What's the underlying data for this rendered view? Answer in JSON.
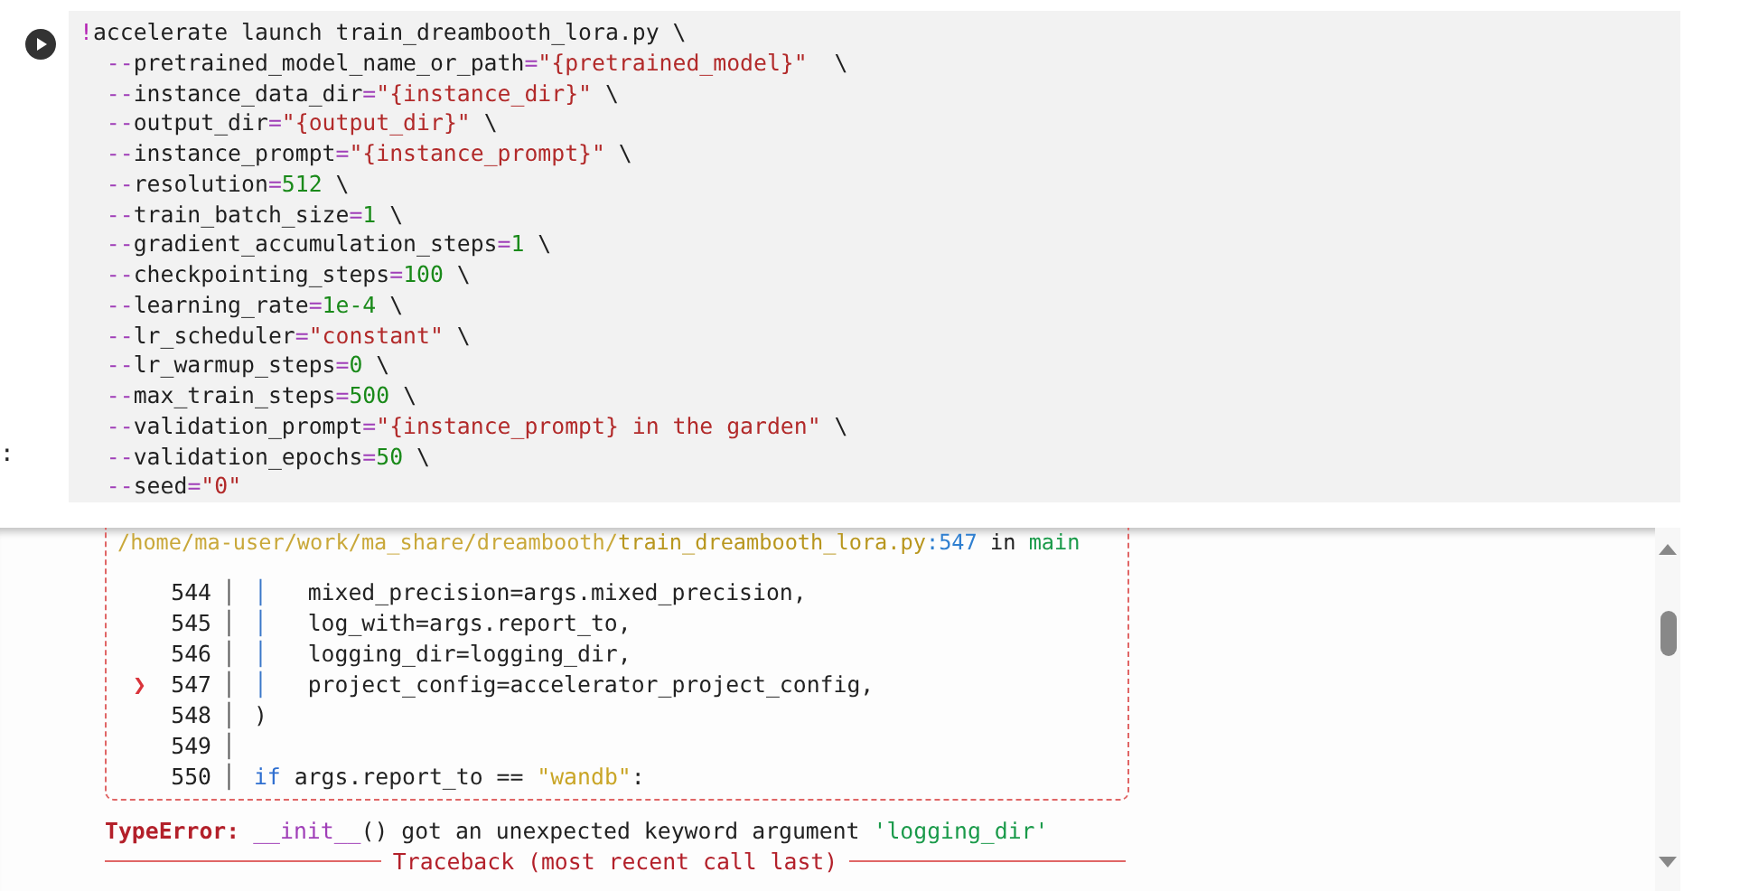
{
  "cell": {
    "code_lines": [
      [
        {
          "kind": "bang",
          "text": "!"
        },
        {
          "kind": "plain",
          "text": "accelerate launch train_dreambooth_lora.py \\"
        }
      ],
      [
        {
          "kind": "op",
          "text": "  --"
        },
        {
          "kind": "plain",
          "text": "pretrained_model_name_or_path"
        },
        {
          "kind": "op",
          "text": "="
        },
        {
          "kind": "string",
          "text": "\"{pretrained_model}\""
        },
        {
          "kind": "plain",
          "text": "  \\"
        }
      ],
      [
        {
          "kind": "op",
          "text": "  --"
        },
        {
          "kind": "plain",
          "text": "instance_data_dir"
        },
        {
          "kind": "op",
          "text": "="
        },
        {
          "kind": "string",
          "text": "\"{instance_dir}\""
        },
        {
          "kind": "plain",
          "text": " \\"
        }
      ],
      [
        {
          "kind": "op",
          "text": "  --"
        },
        {
          "kind": "plain",
          "text": "output_dir"
        },
        {
          "kind": "op",
          "text": "="
        },
        {
          "kind": "string",
          "text": "\"{output_dir}\""
        },
        {
          "kind": "plain",
          "text": " \\"
        }
      ],
      [
        {
          "kind": "op",
          "text": "  --"
        },
        {
          "kind": "plain",
          "text": "instance_prompt"
        },
        {
          "kind": "op",
          "text": "="
        },
        {
          "kind": "string",
          "text": "\"{instance_prompt}\""
        },
        {
          "kind": "plain",
          "text": " \\"
        }
      ],
      [
        {
          "kind": "op",
          "text": "  --"
        },
        {
          "kind": "plain",
          "text": "resolution"
        },
        {
          "kind": "op",
          "text": "="
        },
        {
          "kind": "number",
          "text": "512"
        },
        {
          "kind": "plain",
          "text": " \\"
        }
      ],
      [
        {
          "kind": "op",
          "text": "  --"
        },
        {
          "kind": "plain",
          "text": "train_batch_size"
        },
        {
          "kind": "op",
          "text": "="
        },
        {
          "kind": "number",
          "text": "1"
        },
        {
          "kind": "plain",
          "text": " \\"
        }
      ],
      [
        {
          "kind": "op",
          "text": "  --"
        },
        {
          "kind": "plain",
          "text": "gradient_accumulation_steps"
        },
        {
          "kind": "op",
          "text": "="
        },
        {
          "kind": "number",
          "text": "1"
        },
        {
          "kind": "plain",
          "text": " \\"
        }
      ],
      [
        {
          "kind": "op",
          "text": "  --"
        },
        {
          "kind": "plain",
          "text": "checkpointing_steps"
        },
        {
          "kind": "op",
          "text": "="
        },
        {
          "kind": "number",
          "text": "100"
        },
        {
          "kind": "plain",
          "text": " \\"
        }
      ],
      [
        {
          "kind": "op",
          "text": "  --"
        },
        {
          "kind": "plain",
          "text": "learning_rate"
        },
        {
          "kind": "op",
          "text": "="
        },
        {
          "kind": "number",
          "text": "1e-4"
        },
        {
          "kind": "plain",
          "text": " \\"
        }
      ],
      [
        {
          "kind": "op",
          "text": "  --"
        },
        {
          "kind": "plain",
          "text": "lr_scheduler"
        },
        {
          "kind": "op",
          "text": "="
        },
        {
          "kind": "string",
          "text": "\"constant\""
        },
        {
          "kind": "plain",
          "text": " \\"
        }
      ],
      [
        {
          "kind": "op",
          "text": "  --"
        },
        {
          "kind": "plain",
          "text": "lr_warmup_steps"
        },
        {
          "kind": "op",
          "text": "="
        },
        {
          "kind": "number",
          "text": "0"
        },
        {
          "kind": "plain",
          "text": " \\"
        }
      ],
      [
        {
          "kind": "op",
          "text": "  --"
        },
        {
          "kind": "plain",
          "text": "max_train_steps"
        },
        {
          "kind": "op",
          "text": "="
        },
        {
          "kind": "number",
          "text": "500"
        },
        {
          "kind": "plain",
          "text": " \\"
        }
      ],
      [
        {
          "kind": "op",
          "text": "  --"
        },
        {
          "kind": "plain",
          "text": "validation_prompt"
        },
        {
          "kind": "op",
          "text": "="
        },
        {
          "kind": "string",
          "text": "\"{instance_prompt} in the garden\""
        },
        {
          "kind": "plain",
          "text": " \\"
        }
      ],
      [
        {
          "kind": "op",
          "text": "  --"
        },
        {
          "kind": "plain",
          "text": "validation_epochs"
        },
        {
          "kind": "op",
          "text": "="
        },
        {
          "kind": "number",
          "text": "50"
        },
        {
          "kind": "plain",
          "text": " \\"
        }
      ],
      [
        {
          "kind": "op",
          "text": "  --"
        },
        {
          "kind": "plain",
          "text": "seed"
        },
        {
          "kind": "op",
          "text": "="
        },
        {
          "kind": "string",
          "text": "\"0\""
        }
      ]
    ]
  },
  "gutter_mark": ":",
  "output": {
    "frame_location": [
      {
        "kind": "path",
        "text": "/home/ma-user/work/ma_share/dreambooth/"
      },
      {
        "kind": "file",
        "text": "train_dreambooth_lora.py"
      },
      {
        "kind": "lineno",
        "text": ":547"
      },
      {
        "kind": "plain",
        "text": " in "
      },
      {
        "kind": "func",
        "text": "main"
      }
    ],
    "current_marker": "❯",
    "code_lines": [
      {
        "number": "544",
        "current": false,
        "gutter": "│",
        "segments": [
          {
            "kind": "guide",
            "text": "│   "
          },
          {
            "kind": "plain",
            "text": "mixed_precision=args.mixed_precision,"
          }
        ]
      },
      {
        "number": "545",
        "current": false,
        "gutter": "│",
        "segments": [
          {
            "kind": "guide",
            "text": "│   "
          },
          {
            "kind": "plain",
            "text": "log_with=args.report_to,"
          }
        ]
      },
      {
        "number": "546",
        "current": false,
        "gutter": "│",
        "segments": [
          {
            "kind": "guide",
            "text": "│   "
          },
          {
            "kind": "plain",
            "text": "logging_dir=logging_dir,"
          }
        ]
      },
      {
        "number": "547",
        "current": true,
        "gutter": "│",
        "segments": [
          {
            "kind": "guide",
            "text": "│   "
          },
          {
            "kind": "plain",
            "text": "project_config=accelerator_project_config,"
          }
        ]
      },
      {
        "number": "548",
        "current": false,
        "gutter": "│",
        "segments": [
          {
            "kind": "plain",
            "text": ")"
          }
        ]
      },
      {
        "number": "549",
        "current": false,
        "gutter": "│"
      },
      {
        "number": "550",
        "current": false,
        "gutter": "│",
        "segments": [
          {
            "kind": "keyword",
            "text": "if"
          },
          {
            "kind": "plain",
            "text": " args.report_to == "
          },
          {
            "kind": "str",
            "text": "\"wandb\""
          },
          {
            "kind": "plain",
            "text": ":"
          }
        ]
      }
    ],
    "error": [
      {
        "kind": "error",
        "text": "TypeError: "
      },
      {
        "kind": "dunder",
        "text": "__init__"
      },
      {
        "kind": "plain",
        "text": "() got an unexpected keyword argument "
      },
      {
        "kind": "quote",
        "text": "'logging_dir'"
      }
    ],
    "next_box_title": "Traceback (most recent call last)"
  }
}
